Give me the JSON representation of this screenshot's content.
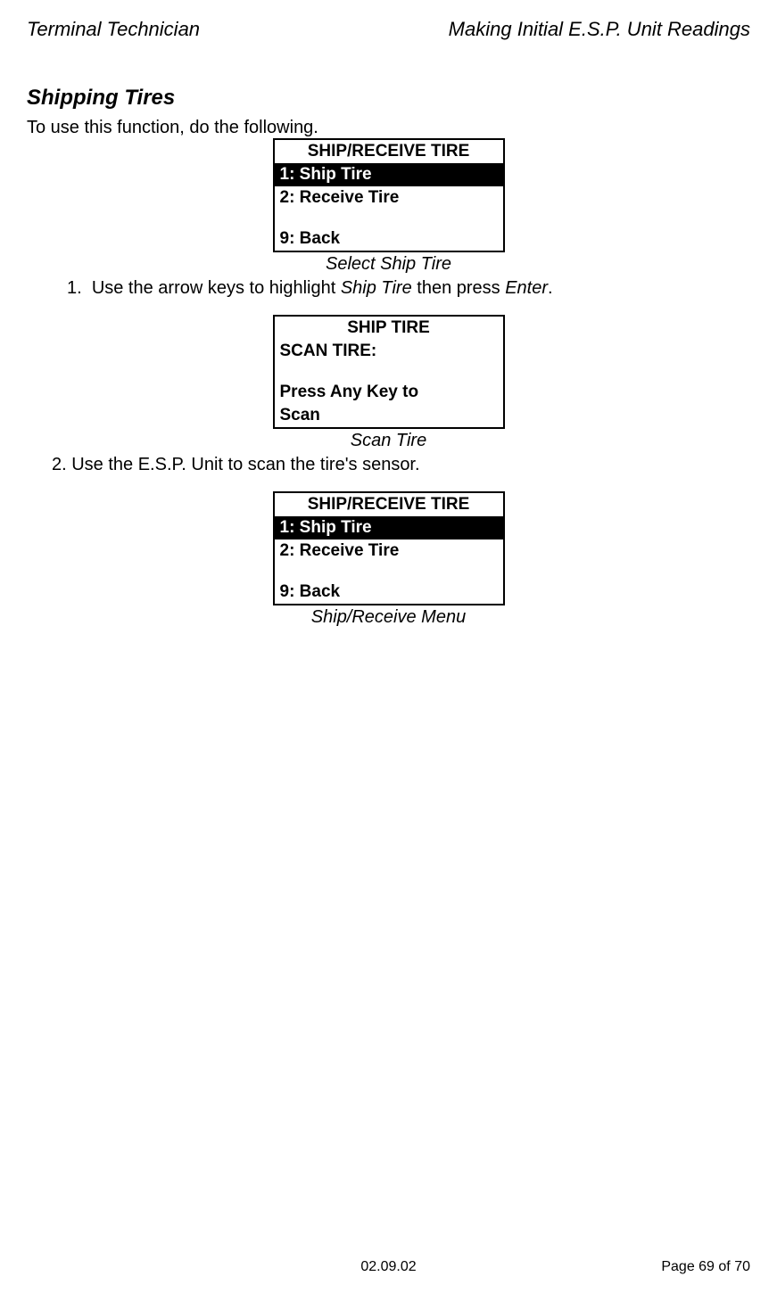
{
  "header": {
    "left": "Terminal Technician",
    "right": "Making Initial E.S.P. Unit Readings"
  },
  "sectionTitle": "Shipping Tires",
  "introText": "To use this function, do the following.",
  "screen1": {
    "title": "SHIP/RECEIVE TIRE",
    "line1": "1: Ship Tire",
    "line2": "2: Receive Tire",
    "line3": "9: Back",
    "caption": "Select Ship Tire"
  },
  "step1": {
    "number": "1.",
    "textStart": "Use the arrow keys to highlight ",
    "italic1": "Ship Tire",
    "textMid": " then press ",
    "italic2": "Enter",
    "textEnd": "."
  },
  "screen2": {
    "title": "SHIP TIRE",
    "line1": "SCAN TIRE:",
    "line2": "Press Any Key to",
    "line3": "Scan",
    "caption": "Scan Tire"
  },
  "step2": {
    "text": "2. Use the E.S.P. Unit to scan the tire's sensor."
  },
  "screen3": {
    "title": "SHIP/RECEIVE TIRE",
    "line1": "1: Ship Tire",
    "line2": "2: Receive Tire",
    "line3": "9: Back",
    "caption": "Ship/Receive Menu"
  },
  "footer": {
    "date": "02.09.02",
    "pageText": "Page 69 of 70"
  }
}
